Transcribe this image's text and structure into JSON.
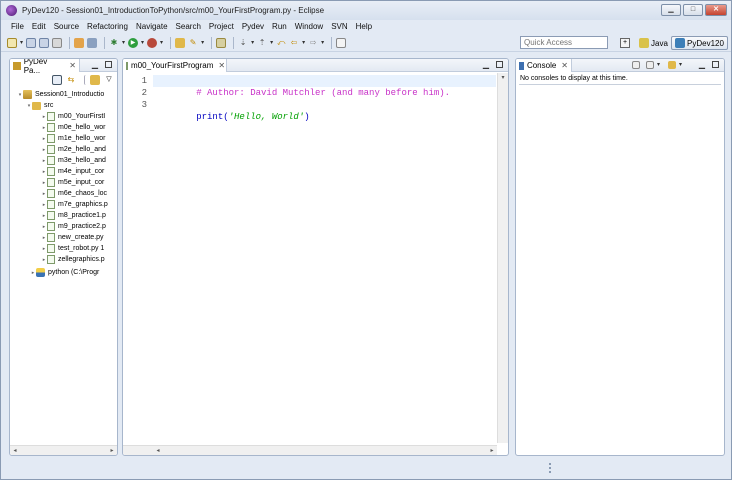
{
  "window": {
    "title": "PyDev120 - Session01_IntroductionToPython/src/m00_YourFirstProgram.py - Eclipse",
    "minimize": "▁",
    "maximize": "□",
    "close": "✕"
  },
  "menu": [
    "File",
    "Edit",
    "Source",
    "Refactoring",
    "Navigate",
    "Search",
    "Project",
    "Pydev",
    "Run",
    "Window",
    "SVN",
    "Help"
  ],
  "toolbar": {
    "quick_access_placeholder": "Quick Access",
    "perspective_java": "Java",
    "perspective_pydev": "PyDev120"
  },
  "explorer": {
    "tab_label": "PyDev Pa...",
    "tree": [
      {
        "label": "Session01_Introductio",
        "indent": 0,
        "type": "project",
        "twisty": "▾"
      },
      {
        "label": "src",
        "indent": 1,
        "type": "folder",
        "twisty": "▾"
      },
      {
        "label": "m00_YourFirstI",
        "indent": 2,
        "type": "file",
        "twisty": "▸"
      },
      {
        "label": "m0e_hello_wor",
        "indent": 2,
        "type": "file",
        "twisty": "▸"
      },
      {
        "label": "m1e_hello_wor",
        "indent": 2,
        "type": "file",
        "twisty": "▸"
      },
      {
        "label": "m2e_hello_and",
        "indent": 2,
        "type": "file",
        "twisty": "▸"
      },
      {
        "label": "m3e_hello_and",
        "indent": 2,
        "type": "file",
        "twisty": "▸"
      },
      {
        "label": "m4e_input_cor",
        "indent": 2,
        "type": "file",
        "twisty": "▸"
      },
      {
        "label": "m5e_input_cor",
        "indent": 2,
        "type": "file",
        "twisty": "▸"
      },
      {
        "label": "m6e_chaos_loc",
        "indent": 2,
        "type": "file",
        "twisty": "▸"
      },
      {
        "label": "m7e_graphics.p",
        "indent": 2,
        "type": "file",
        "twisty": "▸"
      },
      {
        "label": "m8_practice1.p",
        "indent": 2,
        "type": "file",
        "twisty": "▸"
      },
      {
        "label": "m9_practice2.p",
        "indent": 2,
        "type": "file",
        "twisty": "▸"
      },
      {
        "label": "new_create.py",
        "indent": 2,
        "type": "file",
        "twisty": "▸"
      },
      {
        "label": "test_robot.py 1",
        "indent": 2,
        "type": "file",
        "twisty": "▸"
      },
      {
        "label": "zellegraphics.p",
        "indent": 2,
        "type": "file",
        "twisty": "▸"
      },
      {
        "label": "python  (C:\\Progr",
        "indent": 1,
        "type": "python",
        "twisty": "▸"
      }
    ]
  },
  "editor": {
    "tab_label": "m00_YourFirstProgram",
    "lines": [
      {
        "num": "1",
        "text": "# Author: David Mutchler (and many before him).",
        "kind": "comment"
      },
      {
        "num": "2",
        "text": "",
        "kind": "plain"
      },
      {
        "num": "3",
        "prefix": "print(",
        "string": "'Hello, World'",
        "suffix": ")",
        "kind": "call"
      }
    ]
  },
  "console": {
    "tab_label": "Console",
    "message": "No consoles to display at this time."
  },
  "colors": {
    "comment": "#c832c8",
    "string": "#00a000",
    "keyword": "#0000c0"
  }
}
